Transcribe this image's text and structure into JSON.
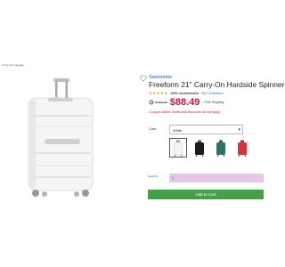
{
  "breadcrumb": "Carry-On Luggage",
  "product": {
    "brand": "Samsonite",
    "title": "Freeform 21\" Carry-On Hardside Spinner",
    "stars": "★★★★★",
    "recommend": "100% recommended",
    "reviews_link": "See 10 reviews »",
    "original_price": "$199.99",
    "sale_price": "$88.49",
    "shipping": "- Free Shipping",
    "coupon_message": "Coupon added. Additional discounts do not apply."
  },
  "options": {
    "color_label": "Color",
    "color_value": "White",
    "swatches": [
      {
        "name": "White",
        "color": "#f2f2f2"
      },
      {
        "name": "Black",
        "color": "#1c1c1c"
      },
      {
        "name": "Teal",
        "color": "#2f6f68"
      },
      {
        "name": "Red",
        "color": "#d8343a"
      }
    ],
    "quantity_label": "Quantity",
    "quantity_value": "1"
  },
  "actions": {
    "add_to_cart": "Add to Cart"
  },
  "colors": {
    "brand_link": "#1a5bb5",
    "sale_red": "#d31245",
    "star": "#f2a900",
    "cart_green": "#44a047",
    "quantity_highlight": "#e6c7ea"
  }
}
